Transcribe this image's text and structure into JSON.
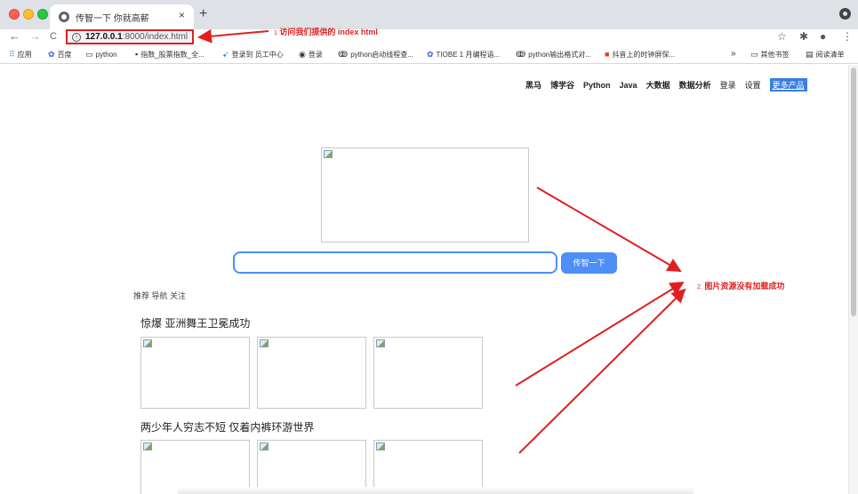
{
  "browser": {
    "tab": {
      "title": "传智一下 你就高薪",
      "close": "×"
    },
    "new_tab": "+",
    "nav": {
      "back": "←",
      "forward": "→",
      "reload": "C"
    },
    "address": {
      "info": "i",
      "host": "127.0.0.1",
      "rest": ":8000/index.html"
    },
    "toolbar_icons": {
      "star": "☆",
      "extensions": "✱",
      "profile": "●",
      "menu": "⋮"
    }
  },
  "bookmarks": {
    "items": [
      {
        "icon": "apps-grid-icon",
        "glyph": "⠿",
        "label": "应用"
      },
      {
        "icon": "baidu-paw-icon",
        "glyph": "✿",
        "label": "百度"
      },
      {
        "icon": "folder-icon",
        "glyph": "▭",
        "label": "python"
      },
      {
        "icon": "stock-site-icon",
        "glyph": "▪",
        "label": "指数_股票指数_全..."
      },
      {
        "icon": "link-icon",
        "glyph": "➹",
        "label": "登录到 员工中心"
      },
      {
        "icon": "globe-icon",
        "glyph": "◉",
        "label": "登录"
      },
      {
        "icon": "csdn-icon",
        "glyph": "ↂ",
        "label": "python启动线程查..."
      },
      {
        "icon": "baidu-paw-icon",
        "glyph": "✿",
        "label": "TIOBE 1 月编程语..."
      },
      {
        "icon": "csdn-icon",
        "glyph": "ↂ",
        "label": "python输出格式对..."
      },
      {
        "icon": "c-site-icon",
        "glyph": "■",
        "label": "抖音上的时钟屏保..."
      }
    ],
    "overflow": "»",
    "other": {
      "glyph": "▭",
      "label": "其他书签"
    },
    "reading_list": {
      "glyph": "▤",
      "label": "阅读清单"
    }
  },
  "page": {
    "topnav": [
      "黑马",
      "博学谷",
      "Python",
      "Java",
      "大数据",
      "数据分析",
      "登录",
      "设置",
      "更多产品"
    ],
    "search_button": "传智一下",
    "subnav": "推荐 导航 关注",
    "sections": [
      "惊爆 亚洲舞王卫冕成功",
      "两少年人穷志不短 仅着内裤环游世界"
    ]
  },
  "annotations": {
    "address": {
      "num": "1",
      "text": "访问我们提供的 index html"
    },
    "images": {
      "num": "2.",
      "text": "图片资源没有加载成功"
    }
  },
  "colors": {
    "annotation_red": "#e02020",
    "accent_blue": "#4e8ef7"
  }
}
